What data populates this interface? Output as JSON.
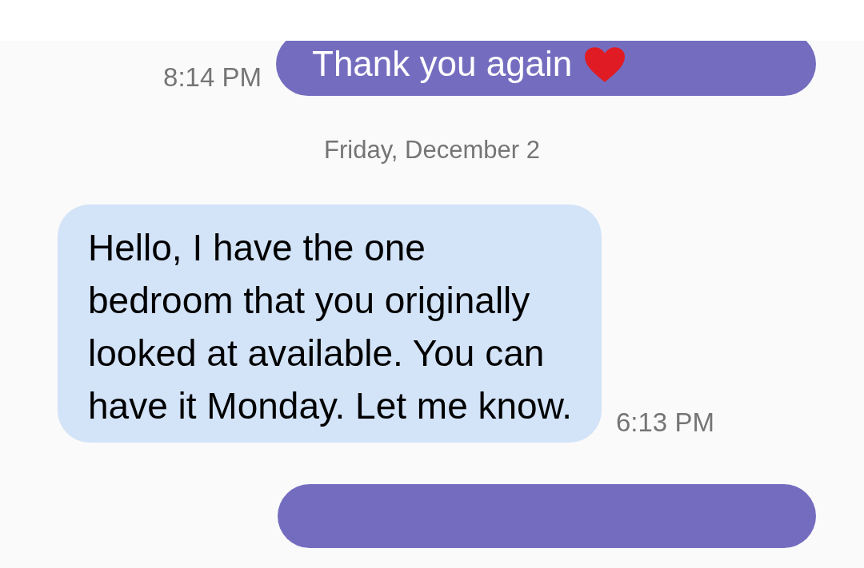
{
  "conversation": [
    {
      "kind": "sent",
      "text": "Thank you again",
      "time": "8:14 PM",
      "heart": true
    },
    {
      "kind": "date",
      "text": "Friday, December 2"
    },
    {
      "kind": "received",
      "text": "Hello, I have the one bedroom that you originally looked at available. You can have it Monday. Let me know.",
      "time": "6:13 PM"
    },
    {
      "kind": "sent"
    }
  ]
}
